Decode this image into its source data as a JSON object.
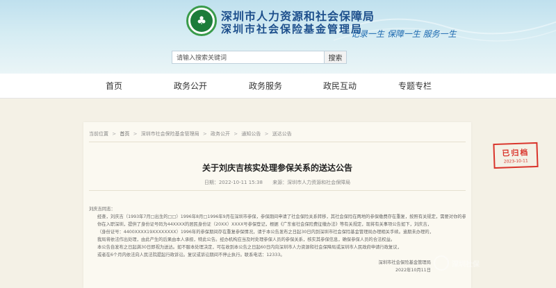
{
  "header": {
    "org_name_1": "深圳市人力资源和社会保障局",
    "org_name_2": "深圳市社会保险基金管理局",
    "slogan": "记录一生 保障一生 服务一生",
    "emblem_icon": "tree-emblem-icon"
  },
  "search": {
    "value": "请输入搜索关键词",
    "button_label": "搜索"
  },
  "nav": {
    "items": [
      {
        "label": "首页"
      },
      {
        "label": "政务公开"
      },
      {
        "label": "政务服务"
      },
      {
        "label": "政民互动"
      },
      {
        "label": "专题专栏"
      }
    ]
  },
  "breadcrumb": {
    "items": [
      "当前位置",
      "首页",
      "深圳市社会保险基金管理局",
      "政务公开",
      "通知公告",
      "送达公告"
    ],
    "separator": ">"
  },
  "article": {
    "title": "关于刘庆吉核实处理参保关系的送达公告",
    "date": "日期：2022-10-11 15:38",
    "source": "来源：深圳市人力资源和社会保障局",
    "greeting": "刘庆吉同志：",
    "paragraphs": [
      "经查，刘庆吉（1993年7月□出生的□□）1996年8月□1996年9月在深圳市参保，参保期间申请了社会保险关系转移，其社会保险在两地的参保缴费存在重复，按照有关规定，需要对你的参保关系进行核实处理。",
      "你在入职深圳，提供了身份证号码为44XXXX的居民身份证（20XX）XXXX号参保登记，根据《广东省社会保险费征缴办法》等有关规定，现将有关事项公告如下，刘庆吉，",
      "（身份证号：4400XXXX19XXXXXXXX）1996年的参保期间存在重复参保情况，请于本公告发布之日起30日内到深圳市社会保险基金管理局办理相关手续。逾期未办理的，",
      "我局将依法作出处理，由此产生的后果由本人承担，特此公告。经办机构应当及时处理参保人员的参保关系，核实其参保信息，确保参保人员的合法权益。",
      "本公告自发布之日起满30日即视为送达。如不服本处理决定，可在收到本公告之日起60日内向深圳市人力资源和社会保障局或深圳市人民政府申请行政复议，",
      "或者在6个月内依法向人民法院提起行政诉讼。复议或诉讼期间不停止执行。联系电话：12333。"
    ],
    "signature": "深圳市社会保险基金管理局",
    "sign_date": "2022年10月11日"
  },
  "stamp": {
    "label": "已归档",
    "date": "2023-10-11"
  },
  "watermark": {
    "text": "深圳社保"
  },
  "colors": {
    "header_blue": "#1d4f8c",
    "stamp_red": "#d9342b",
    "emblem_green": "#1c7c3a",
    "page_bg": "#f4f1e6"
  }
}
